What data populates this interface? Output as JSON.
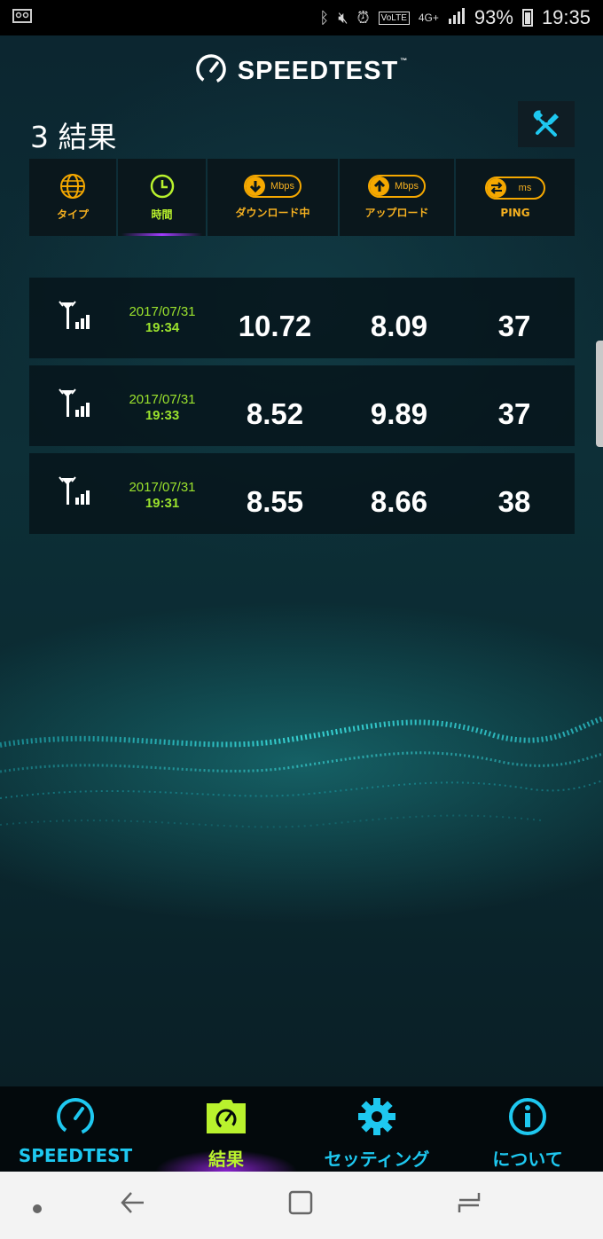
{
  "status_bar": {
    "battery": "93%",
    "clock": "19:35",
    "network": "4G+",
    "volte": "VoLTE"
  },
  "app": {
    "name": "SPEEDTEST",
    "trademark": "™"
  },
  "results": {
    "title": "3 結果"
  },
  "columns": [
    {
      "label": "タイプ",
      "icon": "globe-icon"
    },
    {
      "label": "時間",
      "icon": "clock-icon",
      "active": true
    },
    {
      "label": "ダウンロード中",
      "icon": "download-arrow-icon",
      "unit": "Mbps"
    },
    {
      "label": "アップロード",
      "icon": "upload-arrow-icon",
      "unit": "Mbps"
    },
    {
      "label": "PING",
      "icon": "ping-arrows-icon",
      "unit": "ms"
    }
  ],
  "rows": [
    {
      "date": "2017/07/31",
      "time": "19:34",
      "download": "10.72",
      "upload": "8.09",
      "ping": "37",
      "icon": "cell-signal-icon"
    },
    {
      "date": "2017/07/31",
      "time": "19:33",
      "download": "8.52",
      "upload": "9.89",
      "ping": "37",
      "icon": "cell-signal-icon"
    },
    {
      "date": "2017/07/31",
      "time": "19:31",
      "download": "8.55",
      "upload": "8.66",
      "ping": "38",
      "icon": "cell-signal-icon"
    }
  ],
  "bottom_nav": [
    {
      "label": "SPEEDTEST",
      "icon": "speedometer-icon"
    },
    {
      "label": "結果",
      "icon": "results-folder-icon",
      "active": true
    },
    {
      "label": "セッティング",
      "icon": "gear-icon"
    },
    {
      "label": "について",
      "icon": "info-icon"
    }
  ],
  "colors": {
    "accent_orange": "#f5a800",
    "accent_green": "#b9f22d",
    "accent_cyan": "#1ec8f0",
    "accent_purple": "#a23cff"
  }
}
